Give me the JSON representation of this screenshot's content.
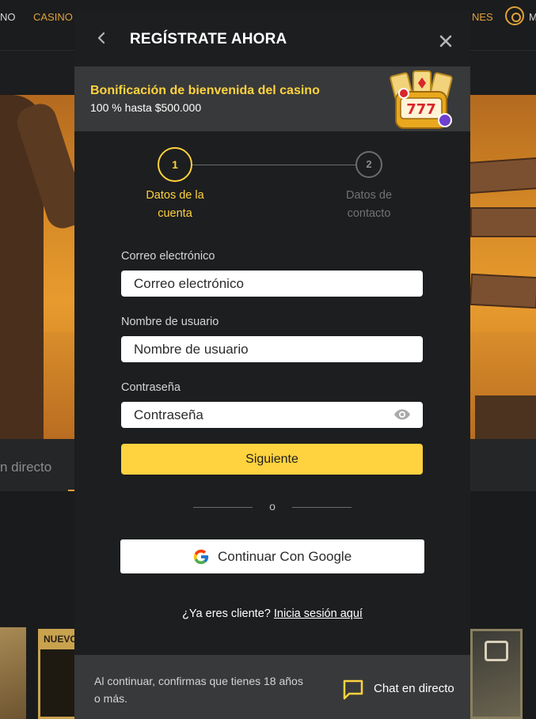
{
  "background": {
    "nav": {
      "item_a": "NO",
      "item_b": "CASINO",
      "item_c": "NES",
      "item_d": "M"
    },
    "live_tab": "n directo",
    "new_badge": "NUEVO"
  },
  "modal": {
    "title": "REGÍSTRATE AHORA",
    "bonus": {
      "title": "Bonificación de bienvenida del casino",
      "subtitle": "100 % hasta $500.000"
    },
    "steps": [
      {
        "number": "1",
        "label": "Datos de la cuenta",
        "active": true
      },
      {
        "number": "2",
        "label": "Datos de contacto",
        "active": false
      }
    ],
    "form": {
      "email": {
        "label": "Correo electrónico",
        "placeholder": "Correo electrónico"
      },
      "username": {
        "label": "Nombre de usuario",
        "placeholder": "Nombre de usuario"
      },
      "password": {
        "label": "Contraseña",
        "placeholder": "Contraseña"
      }
    },
    "next_button": "Siguiente",
    "or_text": "o",
    "google_button": "Continuar Con Google",
    "login_prompt": {
      "text": "¿Ya eres cliente? ",
      "link": "Inicia sesión aquí"
    },
    "footer": {
      "disclaimer": "Al continuar, confirmas que tienes 18 años o más.",
      "chat_label": "Chat en directo"
    }
  },
  "colors": {
    "accent": "#ffd23f",
    "modal_bg": "#1d1e1f",
    "panel_bg": "#38393a",
    "nav_accent": "#e0a23a"
  }
}
